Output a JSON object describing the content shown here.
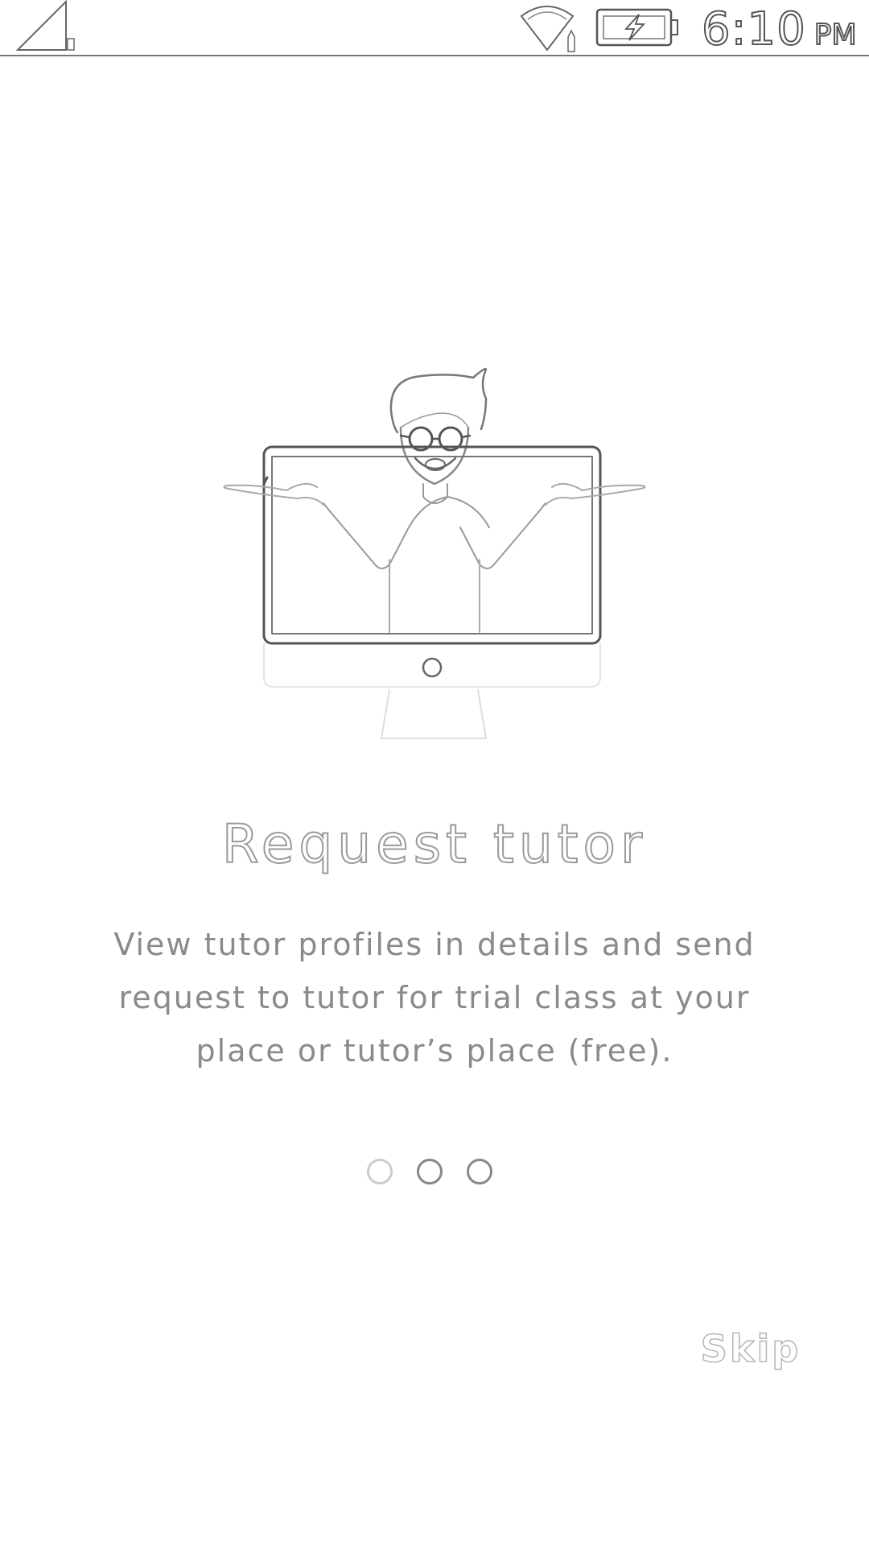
{
  "status_bar": {
    "time": "6:10",
    "ampm": "PM",
    "icons": [
      "signal-icon",
      "wifi-icon",
      "battery-charging-icon"
    ]
  },
  "onboarding": {
    "illustration": "tutor-in-monitor-illustration",
    "title": "Request tutor",
    "description": "View tutor profiles in details and send request to tutor for trial class at your place or tutor’s place (free).",
    "pager": {
      "total": 3,
      "current": 1
    },
    "skip_label": "Skip"
  }
}
